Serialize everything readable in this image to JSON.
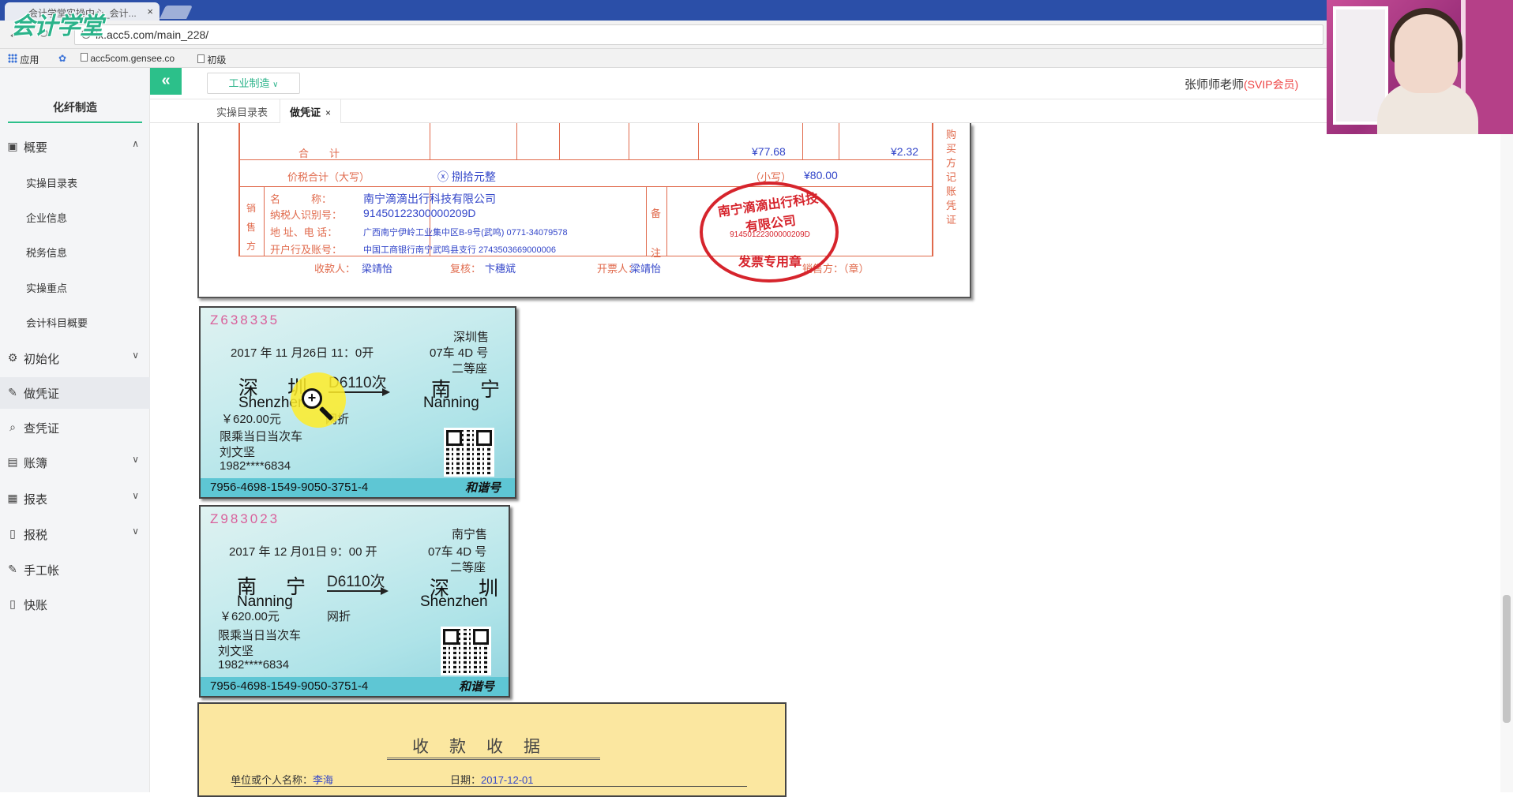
{
  "browser": {
    "tab_title": "会计学堂实操中心_会计...",
    "tab_close": "×",
    "url": "lx.acc5.com/main_228/",
    "bookmarks": [
      "应用",
      "acc5com.gensee.co",
      "初级"
    ]
  },
  "logo_text": "会计学堂",
  "header": {
    "industry_select": "工业制造",
    "teacher_name": "张师师老师",
    "vip_label": "(SVIP会员)"
  },
  "tabs": [
    {
      "label": "实操目录表"
    },
    {
      "label": "做凭证",
      "close": "×"
    }
  ],
  "sidebar": {
    "company": "化纤制造",
    "items": [
      {
        "label": "概要",
        "icon": "overview-icon"
      },
      {
        "label": "初始化",
        "icon": "gear-icon"
      },
      {
        "label": "做凭证",
        "icon": "pen-icon"
      },
      {
        "label": "查凭证",
        "icon": "search-icon"
      },
      {
        "label": "账簿",
        "icon": "book-icon"
      },
      {
        "label": "报表",
        "icon": "report-icon"
      },
      {
        "label": "报税",
        "icon": "document-icon"
      },
      {
        "label": "手工帐",
        "icon": "pen-icon"
      },
      {
        "label": "快账",
        "icon": "document-icon"
      }
    ],
    "sub_items": [
      "实操目录表",
      "企业信息",
      "税务信息",
      "实操重点",
      "会计科目概要"
    ]
  },
  "invoice": {
    "total_label": "合　　计",
    "total_amount": "¥77.68",
    "total_tax": "¥2.32",
    "price_tax_label": "价税合计（大写）",
    "price_tax_upper": "ⓧ 捌拾元整",
    "small_label": "（小写）",
    "small_amount": "¥80.00",
    "seller_side": "销售方",
    "seller_name_label": "名　　　称：",
    "seller_name": "南宁滴滴出行科技有限公司",
    "seller_tax_label": "纳税人识别号：",
    "seller_tax_id": "91450122300000209D",
    "seller_addr_label": "地 址、电 话：",
    "seller_addr": "广西南宁伊岭工业集中区B-9号(武鸣) 0771-34079578",
    "seller_bank_label": "开户行及账号：",
    "seller_bank": "中国工商银行南宁武鸣县支行 2743503669000006",
    "remark": "备注",
    "payee_label": "收款人：",
    "payee": "梁靖怡",
    "reviewer_label": "复核：",
    "reviewer": "卞穗斌",
    "drawer_label": "开票人：",
    "drawer": "梁靖怡",
    "seller_stamp_label": "销售方：（章）",
    "side_label": "购买方记账凭证",
    "seal_name": "南宁滴滴出行科技有限公司",
    "seal_id": "91450122300000209D",
    "seal_text": "发票专用章"
  },
  "tickets": [
    {
      "number": "Z638335",
      "station_tag": "深圳售",
      "datetime": "2017 年 11 月26日 11：0开",
      "seat": "07车 4D 号",
      "seat_class": "二等座",
      "from_cn": "深　圳",
      "from_en": "Shenzhen",
      "train": "D6110次",
      "to_cn": "南　宁",
      "to_en": "Nanning",
      "price": "￥620.00元",
      "discount": "网折",
      "notice": "限乘当日当次车",
      "passenger": "刘文坚",
      "id_no": "1982****6834",
      "serial": "7956-4698-1549-9050-3751-4",
      "brand": "和谐号"
    },
    {
      "number": "Z983023",
      "station_tag": "南宁售",
      "datetime": "2017 年 12 月01日 9：00 开",
      "seat": "07车 4D 号",
      "seat_class": "二等座",
      "from_cn": "南　宁",
      "from_en": "Nanning",
      "train": "D6110次",
      "to_cn": "深　圳",
      "to_en": "Shenzhen",
      "price": "￥620.00元",
      "discount": "网折",
      "notice": "限乘当日当次车",
      "passenger": "刘文坚",
      "id_no": "1982****6834",
      "serial": "7956-4698-1549-9050-3751-4",
      "brand": "和谐号"
    }
  ],
  "receipt": {
    "title": "收款收据",
    "payer_label": "单位或个人名称：",
    "payer": "李海",
    "date_label": "日期：",
    "date": "2017-12-01"
  },
  "colors": {
    "accent": "#2cc08a",
    "invoice_red": "#e06a4c",
    "invoice_blue": "#3346c9",
    "seal_red": "#d6242c",
    "receipt_bg": "#fbe7a0"
  }
}
